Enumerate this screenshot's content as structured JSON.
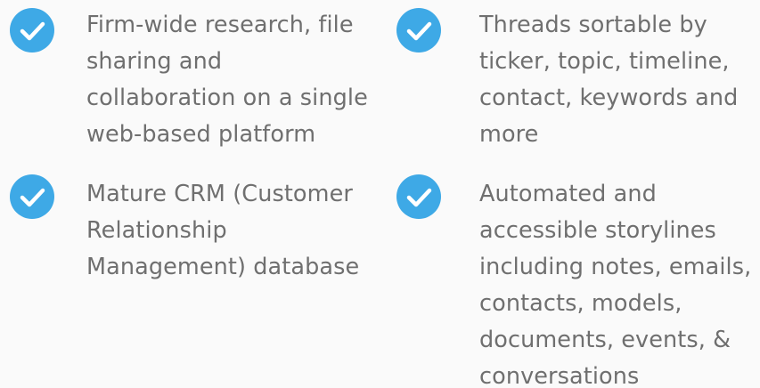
{
  "colors": {
    "check_fill": "#3ea9e6",
    "check_mark": "#ffffff",
    "text": "#6f6f6f",
    "background": "#fafafa"
  },
  "features": [
    {
      "icon": "check-circle-icon",
      "lines": [
        "Firm-wide research, file",
        "sharing and",
        "collaboration on a single",
        "web-based platform"
      ]
    },
    {
      "icon": "check-circle-icon",
      "lines": [
        "Threads sortable by",
        "ticker, topic, timeline,",
        "contact, keywords and",
        "more"
      ]
    },
    {
      "icon": "check-circle-icon",
      "lines": [
        "Mature CRM (Customer",
        "Relationship",
        "Management) database"
      ]
    },
    {
      "icon": "check-circle-icon",
      "lines": [
        "Automated and",
        "accessible storylines",
        "including notes, emails,",
        "contacts, models,",
        "documents, events, &",
        "conversations"
      ]
    }
  ]
}
